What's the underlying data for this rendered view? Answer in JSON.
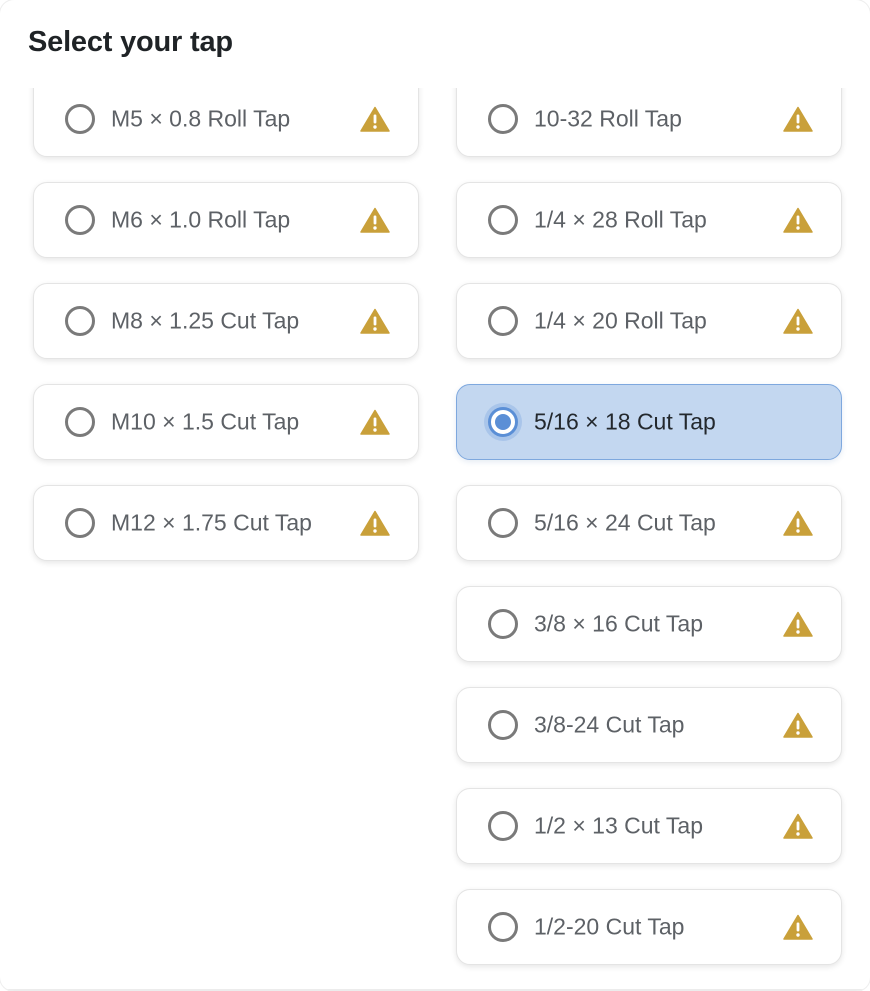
{
  "header": {
    "title": "Select your tap"
  },
  "colors": {
    "warning": "#c9a03a",
    "selected_bg": "#c3d7f0",
    "selected_border": "#7ea8de",
    "radio_selected": "#5b8fd6"
  },
  "options": {
    "left": [
      {
        "label": "M5 × 0.8 Roll Tap",
        "warning": true,
        "selected": false,
        "icon": "warning-icon"
      },
      {
        "label": "M6 × 1.0 Roll Tap",
        "warning": true,
        "selected": false,
        "icon": "warning-icon"
      },
      {
        "label": "M8 × 1.25 Cut Tap",
        "warning": true,
        "selected": false,
        "icon": "warning-icon"
      },
      {
        "label": "M10 × 1.5 Cut Tap",
        "warning": true,
        "selected": false,
        "icon": "warning-icon"
      },
      {
        "label": "M12 × 1.75 Cut Tap",
        "warning": true,
        "selected": false,
        "icon": "warning-icon"
      }
    ],
    "right": [
      {
        "label": "10-32 Roll Tap",
        "warning": true,
        "selected": false,
        "icon": "warning-icon"
      },
      {
        "label": "1/4 × 28 Roll Tap",
        "warning": true,
        "selected": false,
        "icon": "warning-icon"
      },
      {
        "label": "1/4 × 20 Roll Tap",
        "warning": true,
        "selected": false,
        "icon": "warning-icon"
      },
      {
        "label": "5/16 × 18 Cut Tap",
        "warning": false,
        "selected": true,
        "icon": ""
      },
      {
        "label": "5/16 × 24 Cut Tap",
        "warning": true,
        "selected": false,
        "icon": "warning-icon"
      },
      {
        "label": "3/8 × 16 Cut Tap",
        "warning": true,
        "selected": false,
        "icon": "warning-icon"
      },
      {
        "label": "3/8-24 Cut Tap",
        "warning": true,
        "selected": false,
        "icon": "warning-icon"
      },
      {
        "label": "1/2 × 13 Cut Tap",
        "warning": true,
        "selected": false,
        "icon": "warning-icon"
      },
      {
        "label": "1/2-20 Cut Tap",
        "warning": true,
        "selected": false,
        "icon": "warning-icon"
      }
    ]
  }
}
